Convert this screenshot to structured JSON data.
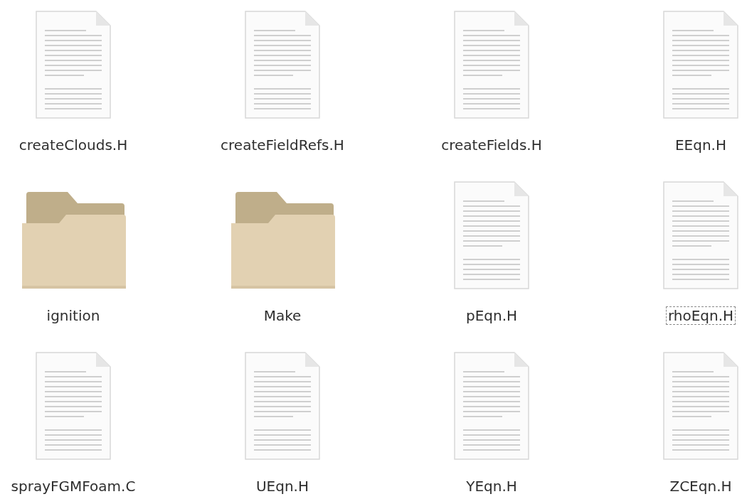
{
  "items": [
    {
      "name": "createClouds.H",
      "kind": "file",
      "focused": false
    },
    {
      "name": "createFieldRefs.H",
      "kind": "file",
      "focused": false
    },
    {
      "name": "createFields.H",
      "kind": "file",
      "focused": false
    },
    {
      "name": "EEqn.H",
      "kind": "file",
      "focused": false
    },
    {
      "name": "ignition",
      "kind": "folder",
      "focused": false
    },
    {
      "name": "Make",
      "kind": "folder",
      "focused": false
    },
    {
      "name": "pEqn.H",
      "kind": "file",
      "focused": false
    },
    {
      "name": "rhoEqn.H",
      "kind": "file",
      "focused": true
    },
    {
      "name": "sprayFGMFoam.C",
      "kind": "file",
      "focused": false
    },
    {
      "name": "UEqn.H",
      "kind": "file",
      "focused": false
    },
    {
      "name": "YEqn.H",
      "kind": "file",
      "focused": false
    },
    {
      "name": "ZCEqn.H",
      "kind": "file",
      "focused": false
    }
  ]
}
